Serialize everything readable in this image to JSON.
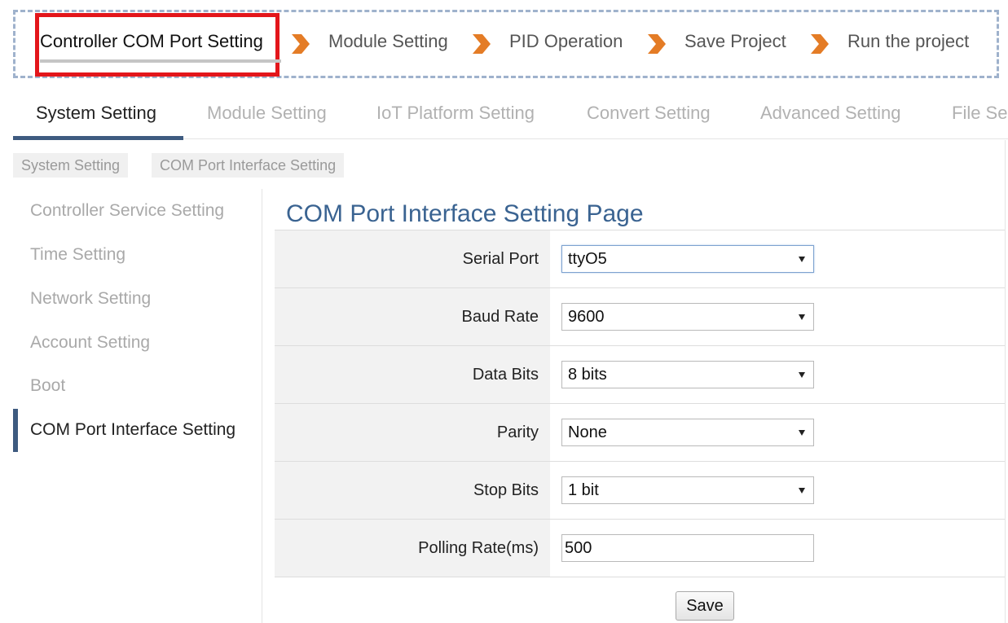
{
  "wizard": {
    "steps": [
      {
        "label": "Controller COM Port Setting",
        "active": true
      },
      {
        "label": "Module Setting"
      },
      {
        "label": "PID Operation"
      },
      {
        "label": "Save Project"
      },
      {
        "label": "Run the project"
      }
    ],
    "arrow_color": "#e47c26",
    "highlight_color": "#e3161b"
  },
  "tabs": [
    {
      "label": "System Setting",
      "active": true
    },
    {
      "label": "Module Setting"
    },
    {
      "label": "IoT Platform Setting"
    },
    {
      "label": "Convert Setting"
    },
    {
      "label": "Advanced Setting"
    },
    {
      "label": "File Se"
    }
  ],
  "breadcrumb": [
    "System Setting",
    "COM Port Interface Setting"
  ],
  "side_nav": [
    {
      "label": "Controller Service Setting"
    },
    {
      "label": "Time Setting"
    },
    {
      "label": "Network Setting"
    },
    {
      "label": "Account Setting"
    },
    {
      "label": "Boot"
    },
    {
      "label": "COM Port Interface Setting",
      "active": true
    }
  ],
  "page": {
    "title": "COM Port Interface Setting Page",
    "fields": [
      {
        "label": "Serial Port",
        "value": "ttyO5",
        "type": "select"
      },
      {
        "label": "Baud Rate",
        "value": "9600",
        "type": "select"
      },
      {
        "label": "Data Bits",
        "value": "8 bits",
        "type": "select"
      },
      {
        "label": "Parity",
        "value": "None",
        "type": "select"
      },
      {
        "label": "Stop Bits",
        "value": "1 bit",
        "type": "select"
      },
      {
        "label": "Polling Rate(ms)",
        "value": "500",
        "type": "input"
      }
    ],
    "save_label": "Save"
  },
  "colors": {
    "accent": "#3e5b80",
    "title": "#3a6391"
  }
}
